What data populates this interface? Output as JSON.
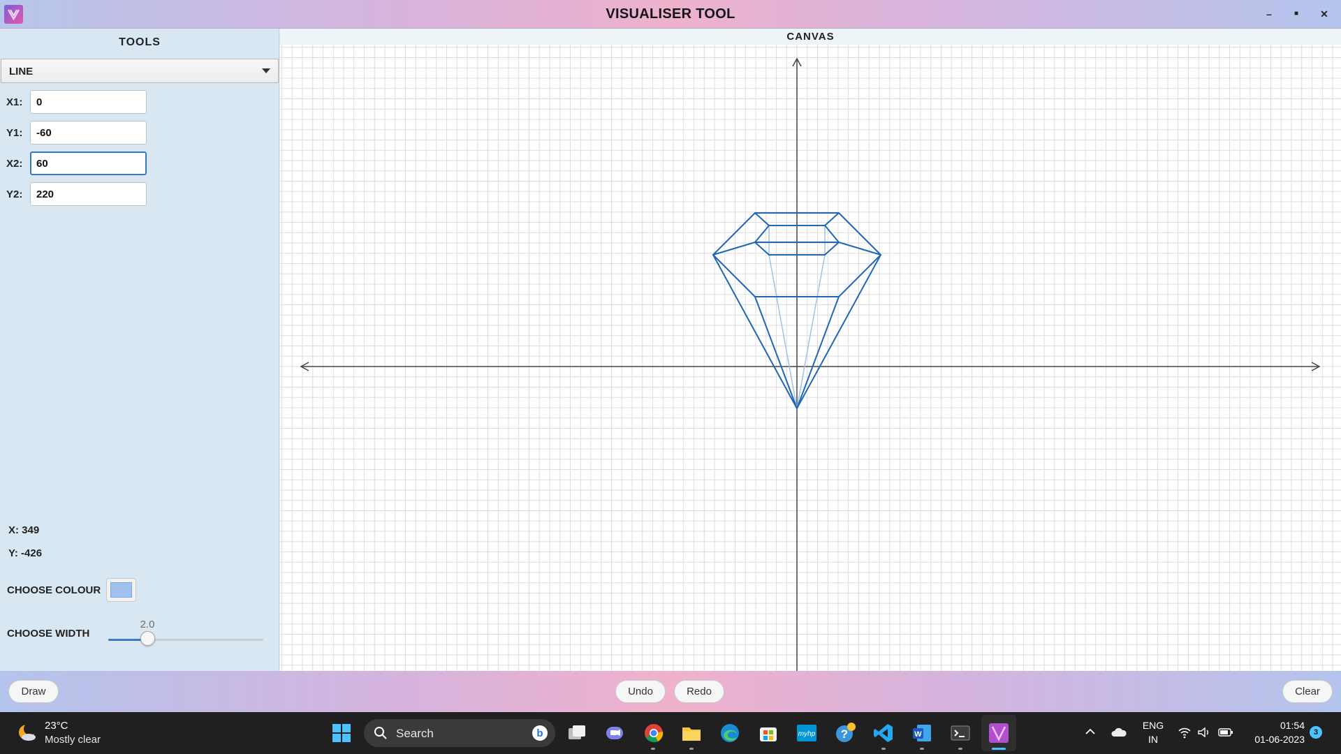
{
  "window": {
    "title": "VISUALISER TOOL",
    "logo_icon": "visualiser-logo-icon",
    "controls": [
      "minimize-icon",
      "maximize-icon",
      "close-icon"
    ]
  },
  "sidebar": {
    "heading": "TOOLS",
    "tool_select": {
      "value": "LINE"
    },
    "fields": [
      {
        "label": "X1:",
        "value": "0"
      },
      {
        "label": "Y1:",
        "value": "-60"
      },
      {
        "label": "X2:",
        "value": "60",
        "focused": true
      },
      {
        "label": "Y2:",
        "value": "220"
      }
    ],
    "cursor_x": "X: 349",
    "cursor_y": "Y: -426",
    "colour_label": "CHOOSE COLOUR",
    "colour_value": "#9ec2ed",
    "width_label": "CHOOSE WIDTH",
    "width_value": "2.0",
    "width_fraction": 0.25
  },
  "canvas": {
    "title": "CANVAS",
    "line_colour": "#2166b4",
    "light_line_colour": "#9ec2ed",
    "axis_colour": "#444444",
    "grid_colour": "#dddddd"
  },
  "bottom_bar": {
    "draw": "Draw",
    "undo": "Undo",
    "redo": "Redo",
    "clear": "Clear"
  },
  "taskbar": {
    "weather_temp": "23°C",
    "weather_desc": "Mostly clear",
    "search_label": "Search",
    "apps": [
      "windows-start-icon",
      "search-icon",
      "bing-icon",
      "task-view-icon",
      "teams-chat-icon",
      "chrome-icon",
      "file-explorer-icon",
      "edge-icon",
      "store-icon",
      "myhp-icon",
      "get-help-icon",
      "vscode-icon",
      "word-icon",
      "terminal-icon",
      "visualiser-app-icon"
    ],
    "language_top": "ENG",
    "language_bottom": "IN",
    "time": "01:54",
    "date": "01-06-2023",
    "notification_count": "3"
  }
}
